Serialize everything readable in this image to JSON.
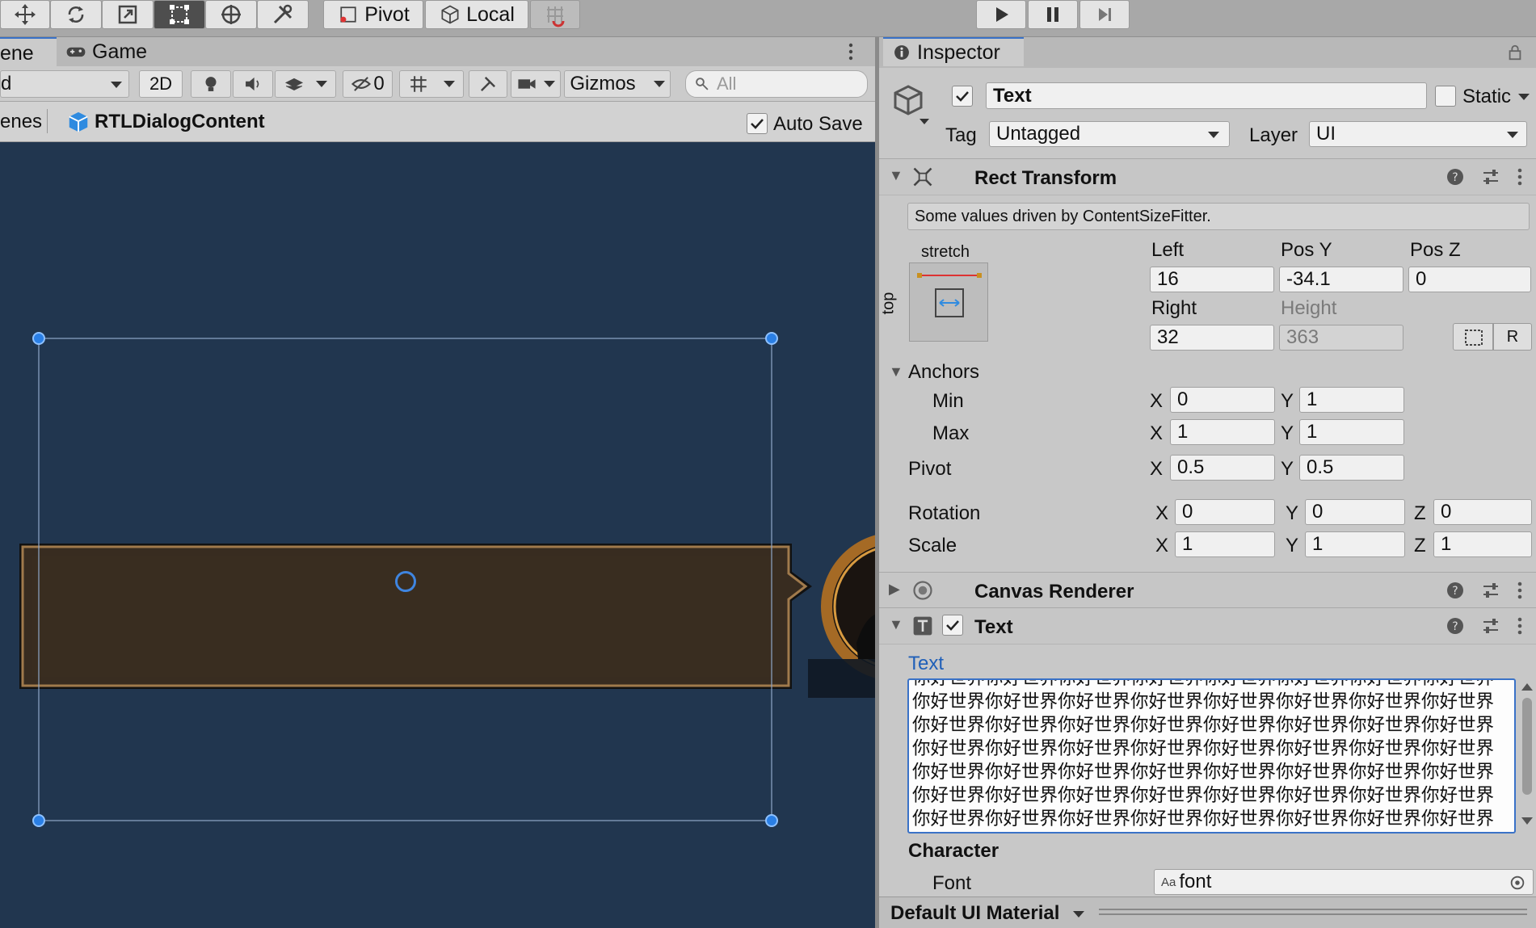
{
  "toolbar": {
    "tools": [
      {
        "name": "move-tool",
        "active": false
      },
      {
        "name": "rotate-tool",
        "active": false
      },
      {
        "name": "scale-tool",
        "active": false
      },
      {
        "name": "rect-tool",
        "active": true
      },
      {
        "name": "transform-tool",
        "active": false
      },
      {
        "name": "custom-tool",
        "active": false
      }
    ],
    "pivot_label": "Pivot",
    "local_label": "Local",
    "playback": [
      "play-icon",
      "pause-icon",
      "step-icon"
    ]
  },
  "scene": {
    "tabs": [
      {
        "label": "ene"
      },
      {
        "label": "Game"
      }
    ],
    "shading_mode": "d",
    "mode_2d": "2D",
    "hidden_count": "0",
    "gizmos_label": "Gizmos",
    "search_placeholder": "All",
    "breadcrumb_prev": "enes",
    "breadcrumb_current": "RTLDialogContent",
    "auto_save_label": "Auto Save",
    "auto_save_checked": true
  },
  "inspector": {
    "tab_label": "Inspector",
    "object_active": true,
    "object_name": "Text",
    "static_label": "Static",
    "tag_label": "Tag",
    "tag_value": "Untagged",
    "layer_label": "Layer",
    "layer_value": "UI",
    "rect_transform": {
      "title": "Rect Transform",
      "notice": "Some values driven by ContentSizeFitter.",
      "anchor_h": "stretch",
      "anchor_v": "top",
      "left_label": "Left",
      "left_value": "16",
      "posy_label": "Pos Y",
      "posy_value": "-34.1",
      "posz_label": "Pos Z",
      "posz_value": "0",
      "right_label": "Right",
      "right_value": "32",
      "height_label": "Height",
      "height_value": "363",
      "anchors_label": "Anchors",
      "min_label": "Min",
      "min_x": "0",
      "min_y": "1",
      "max_label": "Max",
      "max_x": "1",
      "max_y": "1",
      "pivot_label": "Pivot",
      "pivot_x": "0.5",
      "pivot_y": "0.5",
      "rotation_label": "Rotation",
      "rot_x": "0",
      "rot_y": "0",
      "rot_z": "0",
      "scale_label": "Scale",
      "scale_x": "1",
      "scale_y": "1",
      "scale_z": "1",
      "x": "X",
      "y": "Y",
      "z": "Z",
      "raw_button": "R"
    },
    "canvas_renderer": {
      "title": "Canvas Renderer"
    },
    "text_component": {
      "title": "Text",
      "enabled": true,
      "text_label": "Text",
      "text_value": "你好世界你好世界你好世界你好世界你好世界你好世界你好世界你好世界你好世界你好世界你好世界你好世界你好世界你好世界你好世界你好世界你好世界你好世界你好世界你好世界你好世界你好世界你好世界你好世界你好世界你好世界你好世界你好世界你好世界你好世界你好世界你好世界你好世界你好世界你好世界你好世界你好世界你好世界你好世界你好世界你好世界你好世界你好世界你好世界你好世界你好世界你好世界你好世界你好世界你好世界你好世界你好世界你好世界你好世界你好世界你好世界你好世界你好世界你好世界",
      "character_label": "Character",
      "font_label": "Font",
      "font_prefix": "Aa",
      "font_value": "font"
    },
    "material_label": "Default UI Material"
  },
  "colors": {
    "scene_bg": "#21364f",
    "selection_blue": "#3a72c7",
    "link_blue": "#1f5fb8"
  }
}
